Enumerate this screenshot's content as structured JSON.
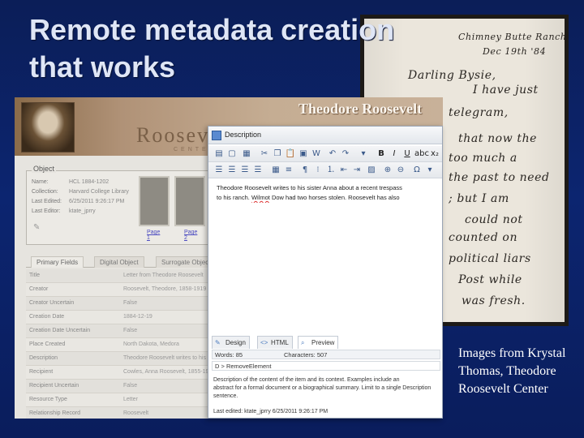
{
  "slide": {
    "title_line1": "Remote metadata creation",
    "title_line2": "that works",
    "caption": "Images from Krystal Thomas, Theodore Roosevelt Center"
  },
  "letter": {
    "lines": [
      "Chimney Butte Ranch",
      "Dec 19th '84",
      "Darling Bysie,",
      "I have just",
      "telegram,",
      "that now the",
      "too much a",
      "the past to need",
      "; but I am",
      "could not",
      "counted on",
      "political liars",
      "Post while",
      "was fresh."
    ]
  },
  "site": {
    "banner_title": "Theodore Roosevelt",
    "logo": "Roosevelt",
    "logo_sub": "CENTER",
    "object_legend": "Object",
    "object_fields": [
      {
        "k": "Name:",
        "v": "HCL 1884-1202"
      },
      {
        "k": "Collection:",
        "v": "Harvard College Library"
      },
      {
        "k": "Last Edited:",
        "v": "6/25/2011 9:26:17 PM"
      },
      {
        "k": "Last Editor:",
        "v": "ktate_jprry"
      }
    ],
    "page_links": [
      "Page 1",
      "Page 2"
    ],
    "tabs": [
      "Primary Fields",
      "Digital Object",
      "Surrogate Object"
    ],
    "rows": [
      {
        "k": "Title",
        "v": "Letter from Theodore Roosevelt"
      },
      {
        "k": "Creator",
        "v": "Roosevelt, Theodore, 1858-1919"
      },
      {
        "k": "Creator Uncertain",
        "v": "False"
      },
      {
        "k": "Creation Date",
        "v": "1884-12-19"
      },
      {
        "k": "Creation Date Uncertain",
        "v": "False"
      },
      {
        "k": "Place Created",
        "v": "North Dakota, Medora"
      },
      {
        "k": "Description",
        "v": "Theodore Roosevelt writes to his"
      },
      {
        "k": "Recipient",
        "v": "Cowles, Anna Roosevelt, 1855-1931"
      },
      {
        "k": "Recipient Uncertain",
        "v": "False"
      },
      {
        "k": "Resource Type",
        "v": "Letter"
      },
      {
        "k": "Relationship Record",
        "v": "Roosevelt"
      }
    ]
  },
  "dialog": {
    "title": "Description",
    "editor_line1": "Theodore Roosevelt writes to his sister Anna about a recent trespass",
    "editor_line2_a": "to his ranch. ",
    "editor_line2_u": "Wilmot",
    "editor_line2_b": " Dow had two horses stolen. Roosevelt has also",
    "tab_design": "Design",
    "tab_html": "HTML",
    "tab_preview": "Preview",
    "words": "Words: 85",
    "characters": "Characters: 507",
    "element_path": "D > RemoveElement",
    "help_lines": [
      "Description of the content of the item and its context. Examples include an",
      "abstract for a formal document or a biographical summary. Limit to a single Description",
      "sentence."
    ],
    "last_edited": "Last edited: ktate_jprry 6/25/2011 9:26:17 PM"
  }
}
